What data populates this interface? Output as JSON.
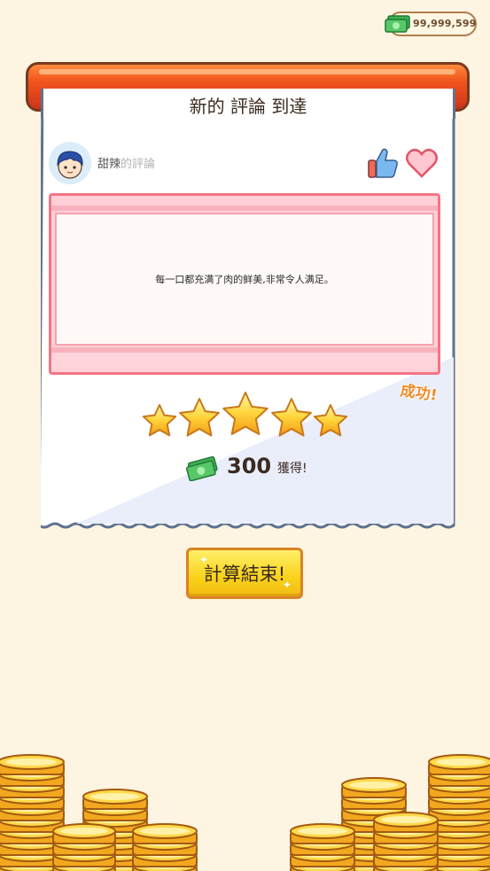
{
  "currency": {
    "amount": "99,999,599",
    "icon": "cash-icon"
  },
  "review": {
    "title": "新的 評論 到達",
    "reviewer_name": "甜辣",
    "reviewer_suffix": "的評論",
    "text": "每一口都充满了肉的鲜美,非常令人满足。",
    "result": "成功!",
    "rating": {
      "value": 5,
      "max": 5
    }
  },
  "reward": {
    "amount": "300",
    "label": "獲得!",
    "icon": "cash-icon"
  },
  "buttons": {
    "end_label": "計算結束!"
  },
  "colors": {
    "background": "#fdf4e1",
    "roller": "#e8481b",
    "review_border": "#f47486",
    "button": "#f9d21a"
  }
}
